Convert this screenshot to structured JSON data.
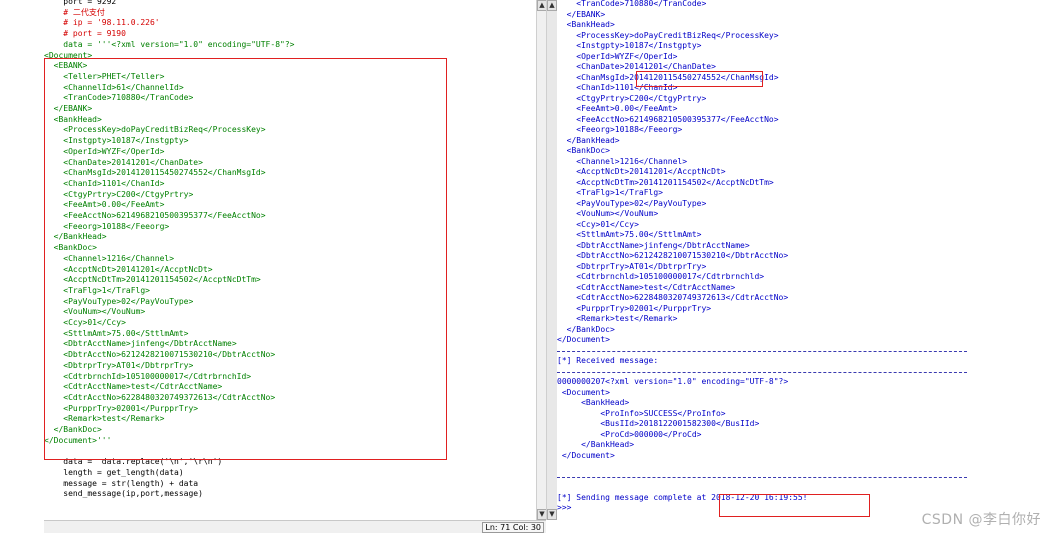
{
  "left_editor": {
    "lines": [
      {
        "text": "    port = 9292",
        "color": "blk"
      },
      {
        "text": "    # 二代支付",
        "color": "red"
      },
      {
        "text": "    # ip = '98.11.0.226'",
        "color": "red"
      },
      {
        "text": "    # port = 9190",
        "color": "red"
      },
      {
        "text": "    data = '''<?xml version=\"1.0\" encoding=\"UTF-8\"?>",
        "color": "grn"
      },
      {
        "text": "<Document>",
        "color": "grn"
      },
      {
        "text": "  <EBANK>",
        "color": "grn"
      },
      {
        "text": "    <Teller>PHET</Teller>",
        "color": "grn"
      },
      {
        "text": "    <ChannelId>61</ChannelId>",
        "color": "grn"
      },
      {
        "text": "    <TranCode>710880</TranCode>",
        "color": "grn"
      },
      {
        "text": "  </EBANK>",
        "color": "grn"
      },
      {
        "text": "  <BankHead>",
        "color": "grn"
      },
      {
        "text": "    <ProcessKey>doPayCreditBizReq</ProcessKey>",
        "color": "grn"
      },
      {
        "text": "    <Instgpty>10187</Instgpty>",
        "color": "grn"
      },
      {
        "text": "    <OperId>WYZF</OperId>",
        "color": "grn"
      },
      {
        "text": "    <ChanDate>20141201</ChanDate>",
        "color": "grn"
      },
      {
        "text": "    <ChanMsgId>2014120115450274552</ChanMsgId>",
        "color": "grn"
      },
      {
        "text": "    <ChanId>1101</ChanId>",
        "color": "grn"
      },
      {
        "text": "    <CtgyPrtry>C200</CtgyPrtry>",
        "color": "grn"
      },
      {
        "text": "    <FeeAmt>0.00</FeeAmt>",
        "color": "grn"
      },
      {
        "text": "    <FeeAcctNo>6214968210500395377</FeeAcctNo>",
        "color": "grn"
      },
      {
        "text": "    <Feeorg>10188</Feeorg>",
        "color": "grn"
      },
      {
        "text": "  </BankHead>",
        "color": "grn"
      },
      {
        "text": "  <BankDoc>",
        "color": "grn"
      },
      {
        "text": "    <Channel>1216</Channel>",
        "color": "grn"
      },
      {
        "text": "    <AccptNcDt>20141201</AccptNcDt>",
        "color": "grn"
      },
      {
        "text": "    <AccptNcDtTm>20141201154502</AccptNcDtTm>",
        "color": "grn"
      },
      {
        "text": "    <TraFlg>1</TraFlg>",
        "color": "grn"
      },
      {
        "text": "    <PayVouType>02</PayVouType>",
        "color": "grn"
      },
      {
        "text": "    <VouNum></VouNum>",
        "color": "grn"
      },
      {
        "text": "    <Ccy>01</Ccy>",
        "color": "grn"
      },
      {
        "text": "    <SttlmAmt>75.00</SttlmAmt>",
        "color": "grn"
      },
      {
        "text": "    <DbtrAcctName>jinfeng</DbtrAcctName>",
        "color": "grn"
      },
      {
        "text": "    <DbtrAcctNo>6212428210071530210</DbtrAcctNo>",
        "color": "grn"
      },
      {
        "text": "    <DbtrprTry>AT01</DbtrprTry>",
        "color": "grn"
      },
      {
        "text": "    <CdtrbrnchId>105100000017</CdtrbrnchId>",
        "color": "grn"
      },
      {
        "text": "    <CdtrAcctName>test</CdtrAcctName>",
        "color": "grn"
      },
      {
        "text": "    <CdtrAcctNo>6228480320749372613</CdtrAcctNo>",
        "color": "grn"
      },
      {
        "text": "    <PurpprTry>02001</PurpprTry>",
        "color": "grn"
      },
      {
        "text": "    <Remark>test</Remark>",
        "color": "grn"
      },
      {
        "text": "  </BankDoc>",
        "color": "grn"
      },
      {
        "text": "</Document>'''",
        "color": "grn"
      },
      {
        "text": "",
        "color": "blk"
      },
      {
        "text": "    data =  data.replace('\\n','\\r\\n')",
        "color": "blk"
      },
      {
        "text": "    length = get_length(data)",
        "color": "blk"
      },
      {
        "text": "    message = str(length) + data",
        "color": "blk"
      },
      {
        "text": "    send_message(ip,port,message)",
        "color": "blk"
      }
    ],
    "status": "Ln: 71 Col: 30"
  },
  "right_shell": {
    "lines": [
      {
        "text": "    <TranCode>710880</TranCode>",
        "color": "blu"
      },
      {
        "text": "  </EBANK>",
        "color": "blu"
      },
      {
        "text": "  <BankHead>",
        "color": "blu"
      },
      {
        "text": "    <ProcessKey>doPayCreditBizReq</ProcessKey>",
        "color": "blu"
      },
      {
        "text": "    <Instgpty>10187</Instgpty>",
        "color": "blu"
      },
      {
        "text": "    <OperId>WYZF</OperId>",
        "color": "blu"
      },
      {
        "text": "    <ChanDate>20141201</ChanDate>",
        "color": "blu"
      },
      {
        "text": "    <ChanMsgId>2014120115450274552</ChanMsgId>",
        "color": "blu"
      },
      {
        "text": "    <ChanId>1101</ChanId>",
        "color": "blu"
      },
      {
        "text": "    <CtgyPrtry>C200</CtgyPrtry>",
        "color": "blu"
      },
      {
        "text": "    <FeeAmt>0.00</FeeAmt>",
        "color": "blu"
      },
      {
        "text": "    <FeeAcctNo>6214968210500395377</FeeAcctNo>",
        "color": "blu"
      },
      {
        "text": "    <Feeorg>10188</Feeorg>",
        "color": "blu"
      },
      {
        "text": "  </BankHead>",
        "color": "blu"
      },
      {
        "text": "  <BankDoc>",
        "color": "blu"
      },
      {
        "text": "    <Channel>1216</Channel>",
        "color": "blu"
      },
      {
        "text": "    <AccptNcDt>20141201</AccptNcDt>",
        "color": "blu"
      },
      {
        "text": "    <AccptNcDtTm>20141201154502</AccptNcDtTm>",
        "color": "blu"
      },
      {
        "text": "    <TraFlg>1</TraFlg>",
        "color": "blu"
      },
      {
        "text": "    <PayVouType>02</PayVouType>",
        "color": "blu"
      },
      {
        "text": "    <VouNum></VouNum>",
        "color": "blu"
      },
      {
        "text": "    <Ccy>01</Ccy>",
        "color": "blu"
      },
      {
        "text": "    <SttlmAmt>75.00</SttlmAmt>",
        "color": "blu"
      },
      {
        "text": "    <DbtrAcctName>jinfeng</DbtrAcctName>",
        "color": "blu"
      },
      {
        "text": "    <DbtrAcctNo>6212428210071530210</DbtrAcctNo>",
        "color": "blu"
      },
      {
        "text": "    <DbtrprTry>AT01</DbtrprTry>",
        "color": "blu"
      },
      {
        "text": "    <Cdtrbrnchld>105100000017</Cdtrbrnchld>",
        "color": "blu"
      },
      {
        "text": "    <CdtrAcctName>test</CdtrAcctName>",
        "color": "blu"
      },
      {
        "text": "    <CdtrAcctNo>6228480320749372613</CdtrAcctNo>",
        "color": "blu"
      },
      {
        "text": "    <PurpprTry>02001</PurpprTry>",
        "color": "blu"
      },
      {
        "text": "    <Remark>test</Remark>",
        "color": "blu"
      },
      {
        "text": "  </BankDoc>",
        "color": "blu"
      },
      {
        "text": "</Document>",
        "color": "blu"
      },
      {
        "text": "",
        "color": "blu",
        "divider": true
      },
      {
        "text": "[*] Received message:",
        "color": "blu"
      },
      {
        "text": "",
        "color": "blu",
        "divider": true
      },
      {
        "text": "0000000207<?xml version=\"1.0\" encoding=\"UTF-8\"?>",
        "color": "blu"
      },
      {
        "text": " <Document>",
        "color": "blu"
      },
      {
        "text": "     <BankHead>",
        "color": "blu"
      },
      {
        "text": "         <ProInfo>SUCCESS</ProInfo>",
        "color": "blu"
      },
      {
        "text": "         <BusIId>2018122001582300</BusIId>",
        "color": "blu"
      },
      {
        "text": "         <ProCd>000000</ProCd>",
        "color": "blu"
      },
      {
        "text": "     </BankHead>",
        "color": "blu"
      },
      {
        "text": " </Document>",
        "color": "blu"
      },
      {
        "text": "",
        "color": "blu"
      },
      {
        "text": "",
        "color": "blu",
        "divider": true
      },
      {
        "text": "",
        "color": "blu"
      },
      {
        "text": "[*] Sending message complete at 2018-12-20 16:19:55!",
        "color": "blu"
      },
      {
        "text": ">>>",
        "color": "blu"
      }
    ]
  },
  "watermark": "CSDN @李白你好"
}
